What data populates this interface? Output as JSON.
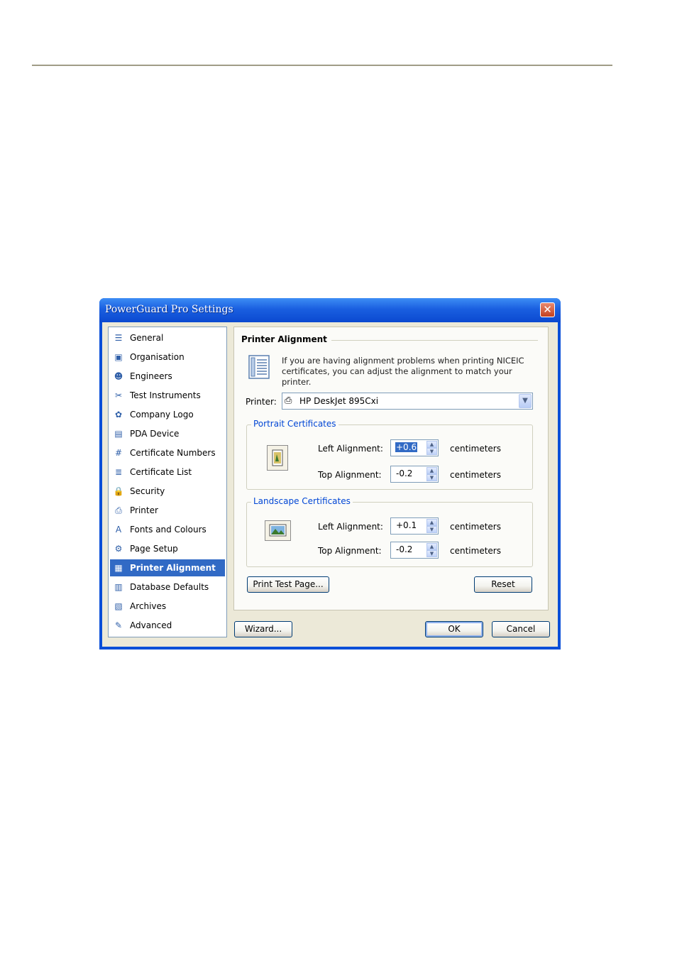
{
  "window": {
    "title": "PowerGuard Pro Settings",
    "close_glyph": "✕"
  },
  "nav": {
    "items": [
      {
        "label": "General",
        "icon": "general-icon",
        "glyph": "☰"
      },
      {
        "label": "Organisation",
        "icon": "organisation-icon",
        "glyph": "▣"
      },
      {
        "label": "Engineers",
        "icon": "engineers-icon",
        "glyph": "☻"
      },
      {
        "label": "Test Instruments",
        "icon": "tools-icon",
        "glyph": "✂"
      },
      {
        "label": "Company Logo",
        "icon": "logo-icon",
        "glyph": "✿"
      },
      {
        "label": "PDA Device",
        "icon": "pda-icon",
        "glyph": "▤"
      },
      {
        "label": "Certificate Numbers",
        "icon": "numbers-icon",
        "glyph": "#"
      },
      {
        "label": "Certificate List",
        "icon": "list-icon",
        "glyph": "≣"
      },
      {
        "label": "Security",
        "icon": "lock-icon",
        "glyph": "🔒"
      },
      {
        "label": "Printer",
        "icon": "printer-icon",
        "glyph": "⎙"
      },
      {
        "label": "Fonts and Colours",
        "icon": "font-icon",
        "glyph": "A"
      },
      {
        "label": "Page Setup",
        "icon": "page-setup-icon",
        "glyph": "⚙"
      },
      {
        "label": "Printer Alignment",
        "icon": "alignment-icon",
        "glyph": "▦",
        "selected": true
      },
      {
        "label": "Database Defaults",
        "icon": "database-icon",
        "glyph": "▥"
      },
      {
        "label": "Archives",
        "icon": "archives-icon",
        "glyph": "▧"
      },
      {
        "label": "Advanced",
        "icon": "advanced-icon",
        "glyph": "✎"
      }
    ]
  },
  "panel": {
    "heading": "Printer Alignment",
    "info": "If you are having alignment problems when printing NICEIC certificates, you can adjust the alignment to match your printer.",
    "printer_label": "Printer:",
    "printer_value": "HP DeskJet 895Cxi",
    "portrait": {
      "title": "Portrait Certificates",
      "left_label": "Left Alignment:",
      "left_value": "+0.6",
      "top_label": "Top Alignment:",
      "top_value": "-0.2",
      "unit": "centimeters"
    },
    "landscape": {
      "title": "Landscape Certificates",
      "left_label": "Left Alignment:",
      "left_value": "+0.1",
      "top_label": "Top Alignment:",
      "top_value": "-0.2",
      "unit": "centimeters"
    },
    "print_test_label": "Print Test Page...",
    "reset_label": "Reset"
  },
  "footer": {
    "wizard_label": "Wizard...",
    "ok_label": "OK",
    "cancel_label": "Cancel"
  },
  "colors": {
    "title_bar": "#0a4fd8",
    "selection": "#316ac5",
    "group_title": "#0046d5",
    "face": "#ece9d8"
  }
}
